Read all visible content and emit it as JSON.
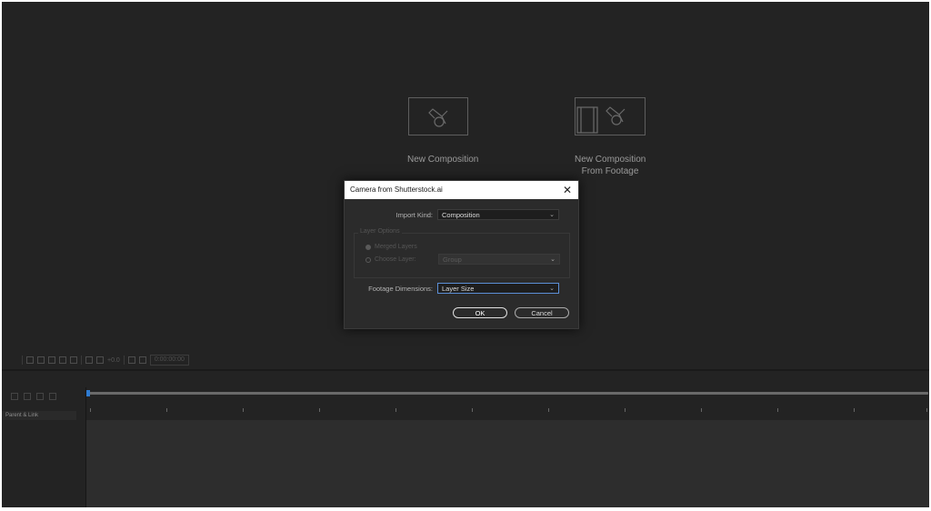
{
  "home": {
    "new_composition": "New Composition",
    "new_from_footage_line1": "New Composition",
    "new_from_footage_line2": "From Footage"
  },
  "toolbar": {
    "offset": "+0.0",
    "timecode": "0:00:00:00"
  },
  "timeline": {
    "parent_link_header": "Parent & Link"
  },
  "dialog": {
    "title": "Camera from Shutterstock.ai",
    "import_kind_label": "Import Kind:",
    "import_kind_value": "Composition",
    "layer_options_legend": "Layer Options",
    "merged_layers": "Merged Layers",
    "choose_layer": "Choose Layer:",
    "choose_layer_value": "Group",
    "footage_dimensions_label": "Footage Dimensions:",
    "footage_dimensions_value": "Layer Size",
    "ok": "OK",
    "cancel": "Cancel"
  }
}
